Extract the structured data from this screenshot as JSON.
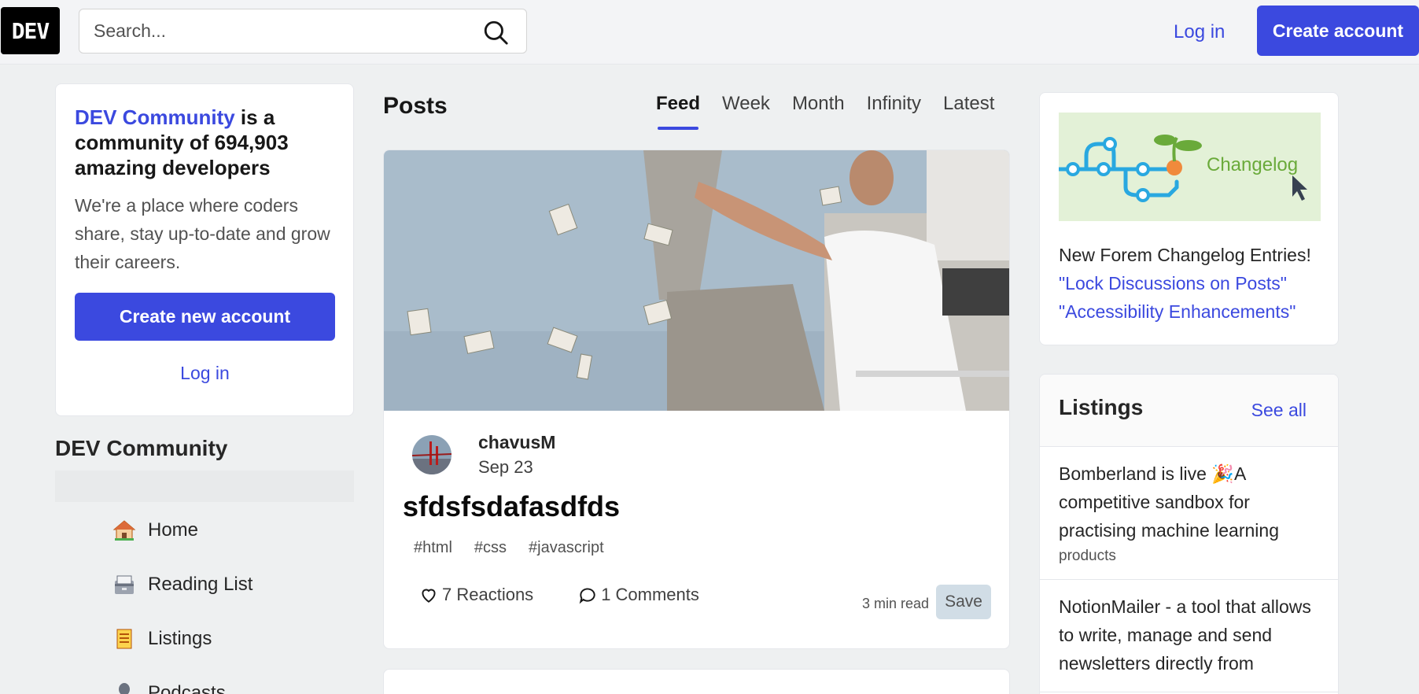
{
  "header": {
    "logo": "DEV",
    "search_placeholder": "Search...",
    "login_label": "Log in",
    "create_account_label": "Create account"
  },
  "intro": {
    "brand": "DEV Community",
    "title_rest": " is a community of 694,903 amazing developers",
    "description": "We're a place where coders share, stay up-to-date and grow their careers.",
    "create_button": "Create new account",
    "login_label": "Log in"
  },
  "sidebar": {
    "heading": "DEV Community",
    "items": [
      {
        "label": "Home",
        "icon": "house-icon"
      },
      {
        "label": "Reading List",
        "icon": "card-box-icon"
      },
      {
        "label": "Listings",
        "icon": "scroll-icon"
      },
      {
        "label": "Podcasts",
        "icon": "microphone-icon"
      }
    ]
  },
  "main": {
    "title": "Posts",
    "tabs": [
      {
        "label": "Feed",
        "active": true
      },
      {
        "label": "Week",
        "active": false
      },
      {
        "label": "Month",
        "active": false
      },
      {
        "label": "Infinity",
        "active": false
      },
      {
        "label": "Latest",
        "active": false
      }
    ],
    "post": {
      "author": "chavusM",
      "date": "Sep 23",
      "title": "sfdsfsdafasdfds",
      "tags": [
        "#html",
        "#css",
        "#javascript"
      ],
      "reactions": "7 Reactions",
      "comments": "1 Comments",
      "read_time": "3 min read",
      "save_label": "Save"
    }
  },
  "changelog": {
    "image_label": "Changelog",
    "heading": "New Forem Changelog Entries!",
    "links": [
      "\"Lock Discussions on Posts\"",
      "\"Accessibility Enhancements\""
    ]
  },
  "listings": {
    "title": "Listings",
    "see_all": "See all",
    "items": [
      {
        "title": "Bomberland is live 🎉A competitive sandbox for practising machine learning",
        "category": "products"
      },
      {
        "title": "NotionMailer - a tool that allows to write, manage and send newsletters directly from",
        "category": ""
      }
    ]
  },
  "colors": {
    "accent": "#3b49df",
    "background": "#eef0f1"
  }
}
